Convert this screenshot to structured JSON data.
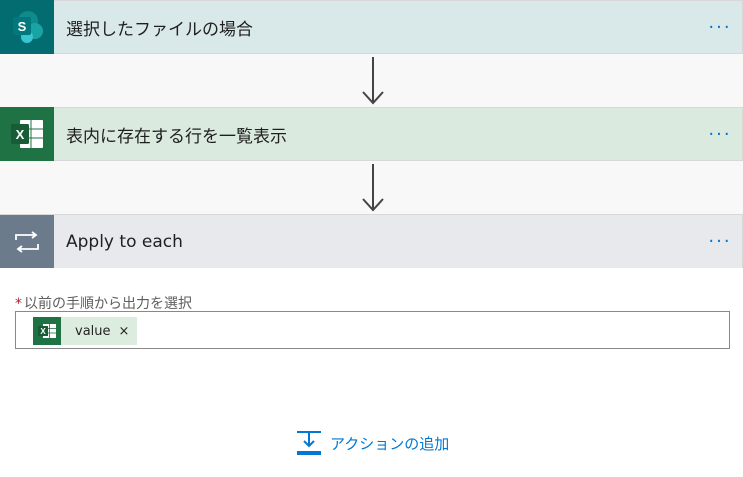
{
  "steps": [
    {
      "title": "選択したファイルの場合",
      "more": "···"
    },
    {
      "title": "表内に存在する行を一覧表示",
      "more": "···"
    },
    {
      "title": "Apply to each",
      "more": "···"
    }
  ],
  "apply_to_each": {
    "field_required_marker": "*",
    "field_label": "以前の手順から出力を選択",
    "token": {
      "label": "value",
      "remove": "×"
    }
  },
  "add_action": {
    "label": "アクションの追加"
  },
  "colors": {
    "sharepoint": "#036c70",
    "excel": "#1f7244",
    "loop": "#6c7b8c",
    "link": "#0078d4"
  }
}
